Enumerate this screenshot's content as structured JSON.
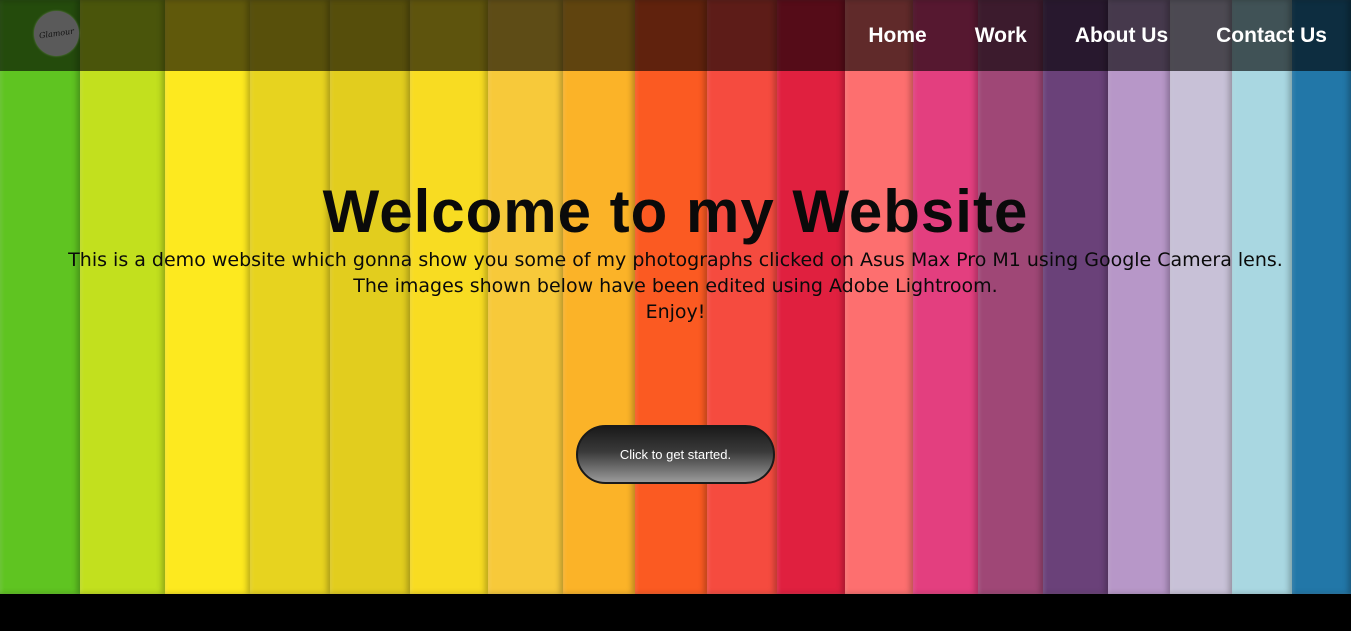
{
  "brand": {
    "logo_text": "Glamour"
  },
  "nav": {
    "items": [
      {
        "label": "Home"
      },
      {
        "label": "Work"
      },
      {
        "label": "About Us"
      },
      {
        "label": "Contact Us"
      }
    ]
  },
  "hero": {
    "headline": "Welcome to my Website",
    "intro_lines": [
      "This is a demo website which gonna show you some of my photographs clicked on Asus Max Pro M1 using Google Camera lens.",
      "The images shown below have been edited using Adobe Lightroom.",
      "Enjoy!"
    ],
    "cta_label": "Click to get started."
  },
  "colors": {
    "stripes": [
      "#5fc421",
      "#c2e01e",
      "#fde91f",
      "#e7d31f",
      "#e2cd1e",
      "#f8dc22",
      "#f7c93a",
      "#fbb328",
      "#fb5a22",
      "#f54b3f",
      "#e0203f",
      "#fd6f6f",
      "#e33f7f",
      "#9f4776",
      "#6a4179",
      "#b797c8",
      "#c8c1d7",
      "#a9d7e1",
      "#2277a8"
    ],
    "navbar": "rgba(0,0,0,0.62)",
    "page_bottom": "#000000"
  }
}
